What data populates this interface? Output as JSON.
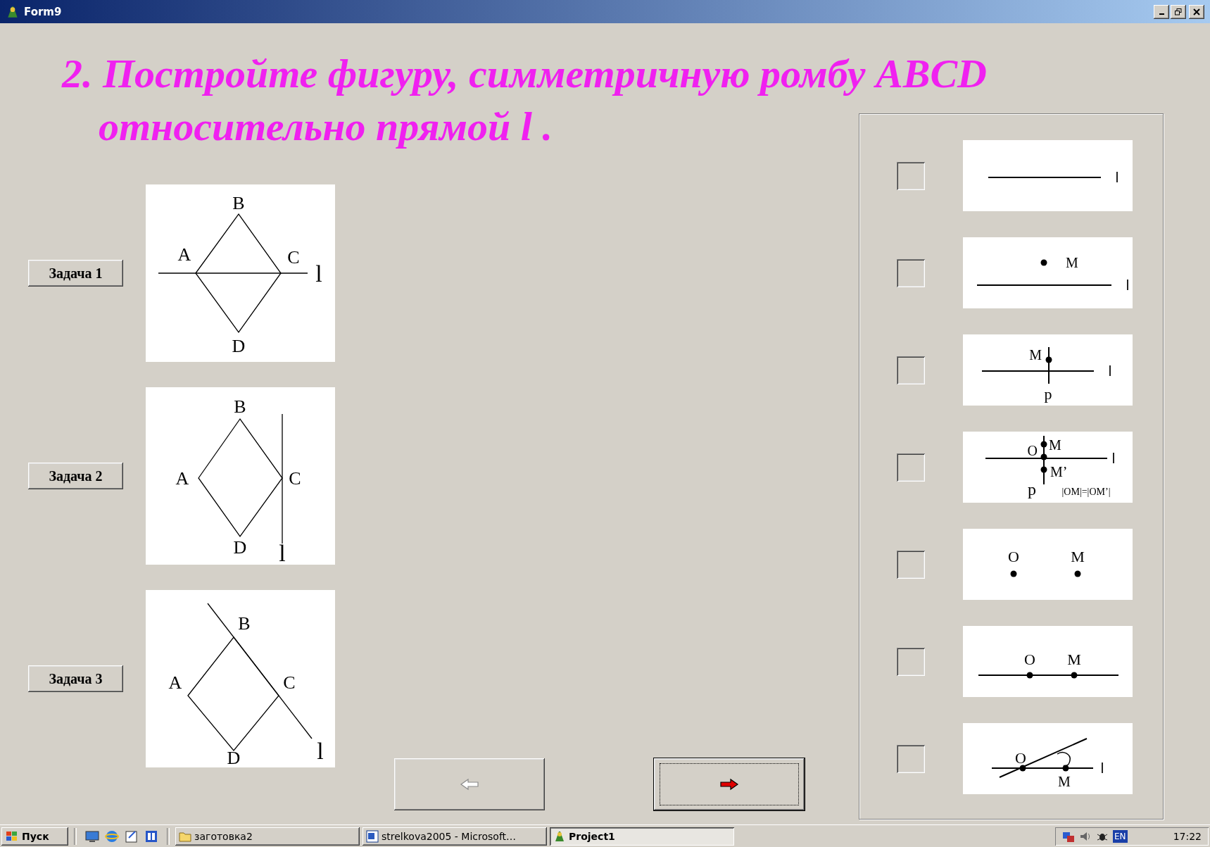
{
  "window": {
    "title": "Form9"
  },
  "heading": "2. Постройте фигуру, симметричную ромбу ABCD\nотносительно прямой l .",
  "tasks": [
    {
      "button": "Задача 1",
      "kind": "horizontal",
      "labels": [
        "A",
        "B",
        "C",
        "D",
        "l"
      ]
    },
    {
      "button": "Задача 2",
      "kind": "vertical",
      "labels": [
        "A",
        "B",
        "C",
        "D",
        "l"
      ]
    },
    {
      "button": "Задача 3",
      "kind": "diagonal",
      "labels": [
        "A",
        "B",
        "C",
        "D",
        "l"
      ]
    }
  ],
  "navigation": {
    "back": {
      "disabled": true
    },
    "forward": {
      "disabled": false,
      "focused": true
    }
  },
  "options": [
    {
      "kind": "line",
      "checked": false,
      "labels": [
        "l"
      ]
    },
    {
      "kind": "point_line",
      "checked": false,
      "labels": [
        "M",
        "l"
      ]
    },
    {
      "kind": "perpendicular",
      "checked": false,
      "labels": [
        "M",
        "l",
        "p"
      ]
    },
    {
      "kind": "symmetric_point",
      "checked": false,
      "labels": [
        "O",
        "M",
        "l",
        "M’",
        "p",
        "|OM|=|OM’|"
      ]
    },
    {
      "kind": "two_points",
      "checked": false,
      "labels": [
        "O",
        "M"
      ]
    },
    {
      "kind": "points_on_line",
      "checked": false,
      "labels": [
        "O",
        "M"
      ]
    },
    {
      "kind": "rotation",
      "checked": false,
      "labels": [
        "O",
        "l",
        "M"
      ]
    }
  ],
  "taskbar": {
    "start": "Пуск",
    "tasks": [
      {
        "label": "заготовка2",
        "selected": false
      },
      {
        "label": "strelkova2005 - Microsoft…",
        "selected": false
      },
      {
        "label": "Project1",
        "selected": true
      }
    ],
    "language": "EN",
    "time": "17:22"
  }
}
